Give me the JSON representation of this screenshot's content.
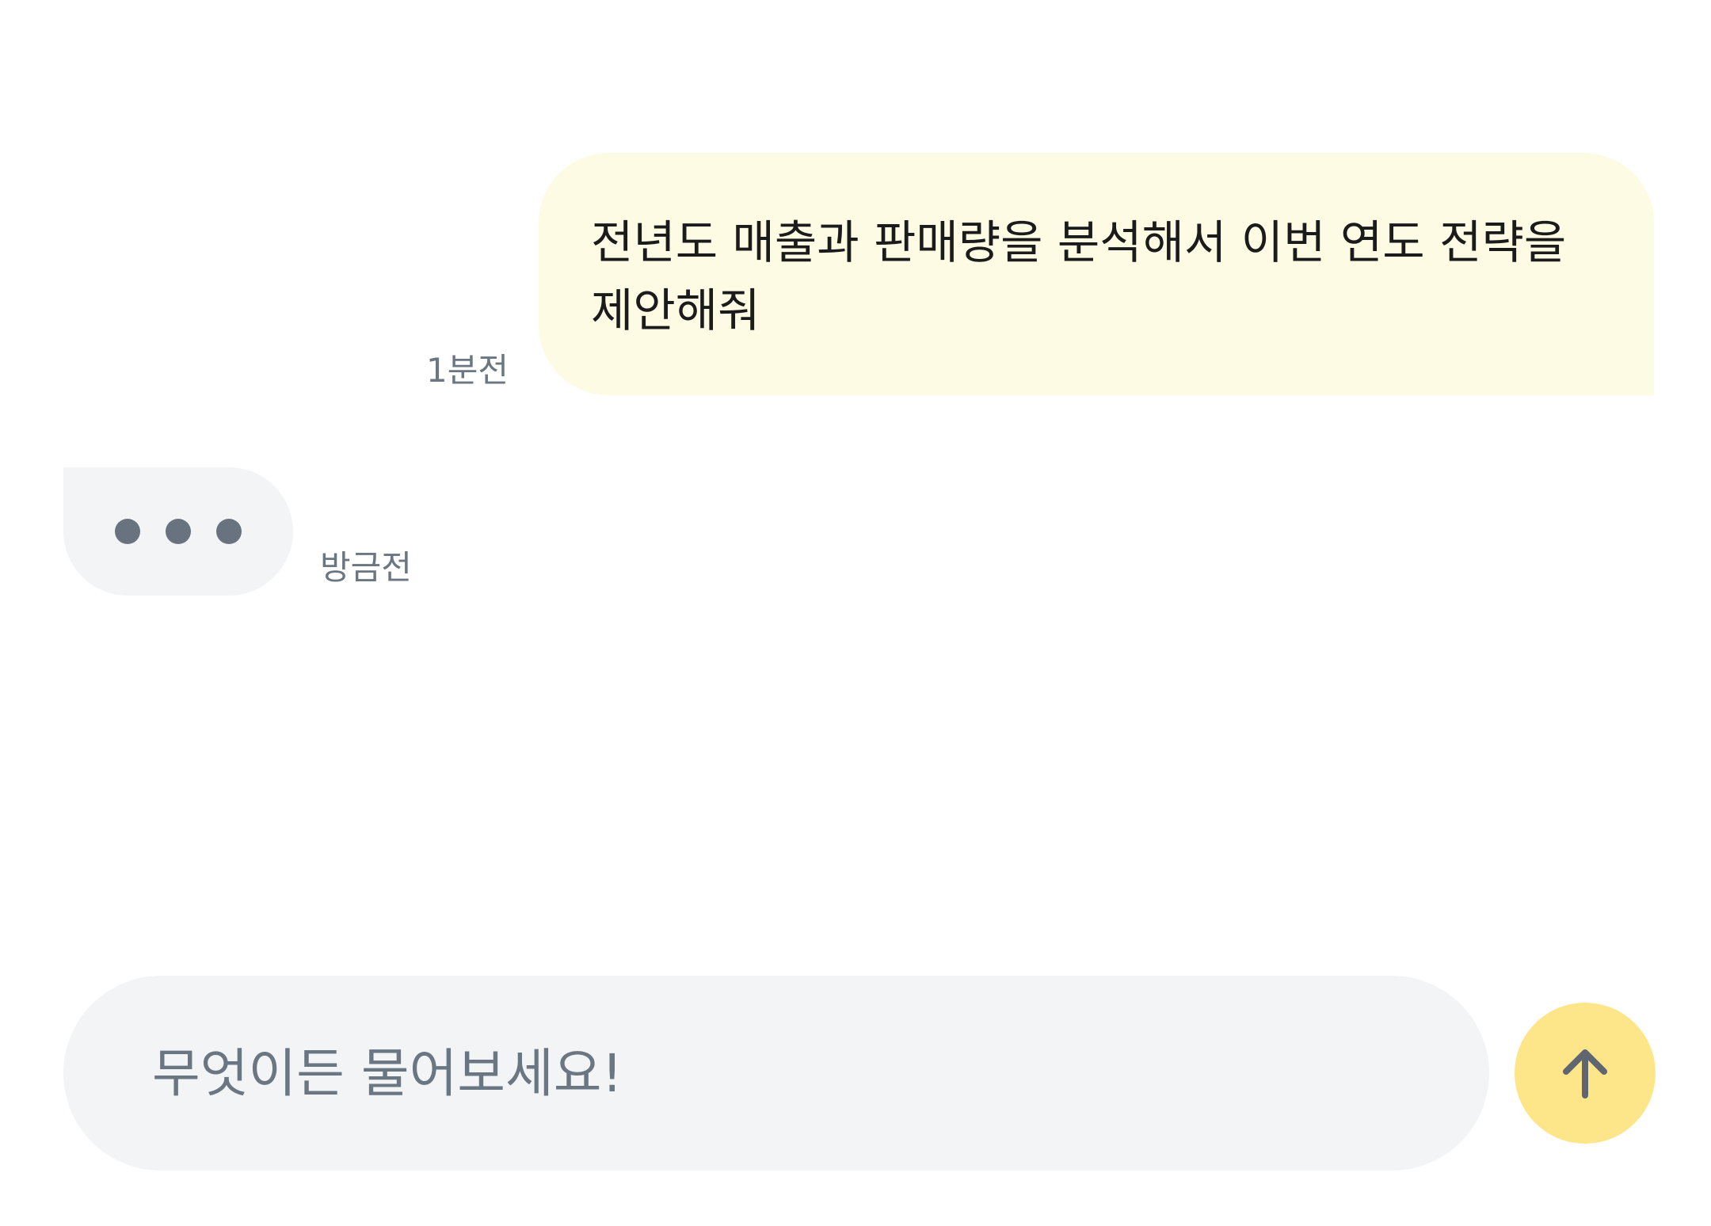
{
  "messages": [
    {
      "role": "user",
      "text": "전년도 매출과 판매량을 분석해서 이번 연도 전략을 제안해줘",
      "time": "1분전"
    },
    {
      "role": "assistant",
      "status": "typing",
      "time": "방금전"
    }
  ],
  "composer": {
    "placeholder": "무엇이든 물어보세요!",
    "value": "",
    "send_icon": "arrow-up-icon"
  },
  "colors": {
    "user_bubble": "#fefbe5",
    "bot_bubble": "#f3f4f6",
    "typing_dot": "#69737f",
    "send_button": "#fde68a",
    "timestamp": "#6b7683"
  }
}
